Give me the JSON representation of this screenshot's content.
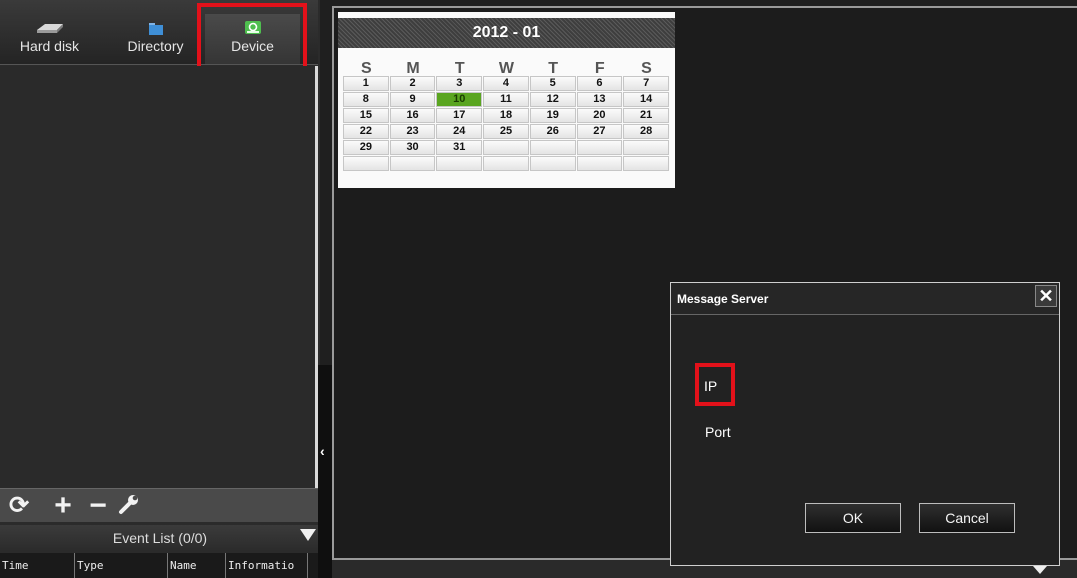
{
  "tabs": [
    {
      "label": "Hard disk",
      "icon": "hard-disk-icon"
    },
    {
      "label": "Directory",
      "icon": "folder-icon"
    },
    {
      "label": "Device",
      "icon": "device-icon"
    }
  ],
  "toolbar": {
    "refresh_icon": "refresh-icon",
    "add_icon": "plus-icon",
    "remove_icon": "minus-icon",
    "settings_icon": "wrench-icon"
  },
  "event_list": {
    "title": "Event List (0/0)",
    "columns": [
      "Time",
      "Type",
      "Name",
      "Informatio"
    ]
  },
  "calendar": {
    "header": "2012 - 01",
    "weekdays": [
      "S",
      "M",
      "T",
      "W",
      "T",
      "F",
      "S"
    ],
    "today": "10",
    "days": [
      "1",
      "2",
      "3",
      "4",
      "5",
      "6",
      "7",
      "8",
      "9",
      "10",
      "11",
      "12",
      "13",
      "14",
      "15",
      "16",
      "17",
      "18",
      "19",
      "20",
      "21",
      "22",
      "23",
      "24",
      "25",
      "26",
      "27",
      "28",
      "29",
      "30",
      "31",
      "",
      "",
      "",
      "",
      "",
      "",
      "",
      "",
      "",
      "",
      ""
    ]
  },
  "dialog": {
    "title": "Message Server",
    "ip_label": "IP",
    "port_label": "Port",
    "ok_label": "OK",
    "cancel_label": "Cancel",
    "close_symbol": "✕"
  },
  "colors": {
    "highlight": "#e3111a",
    "today": "#5aa520"
  }
}
